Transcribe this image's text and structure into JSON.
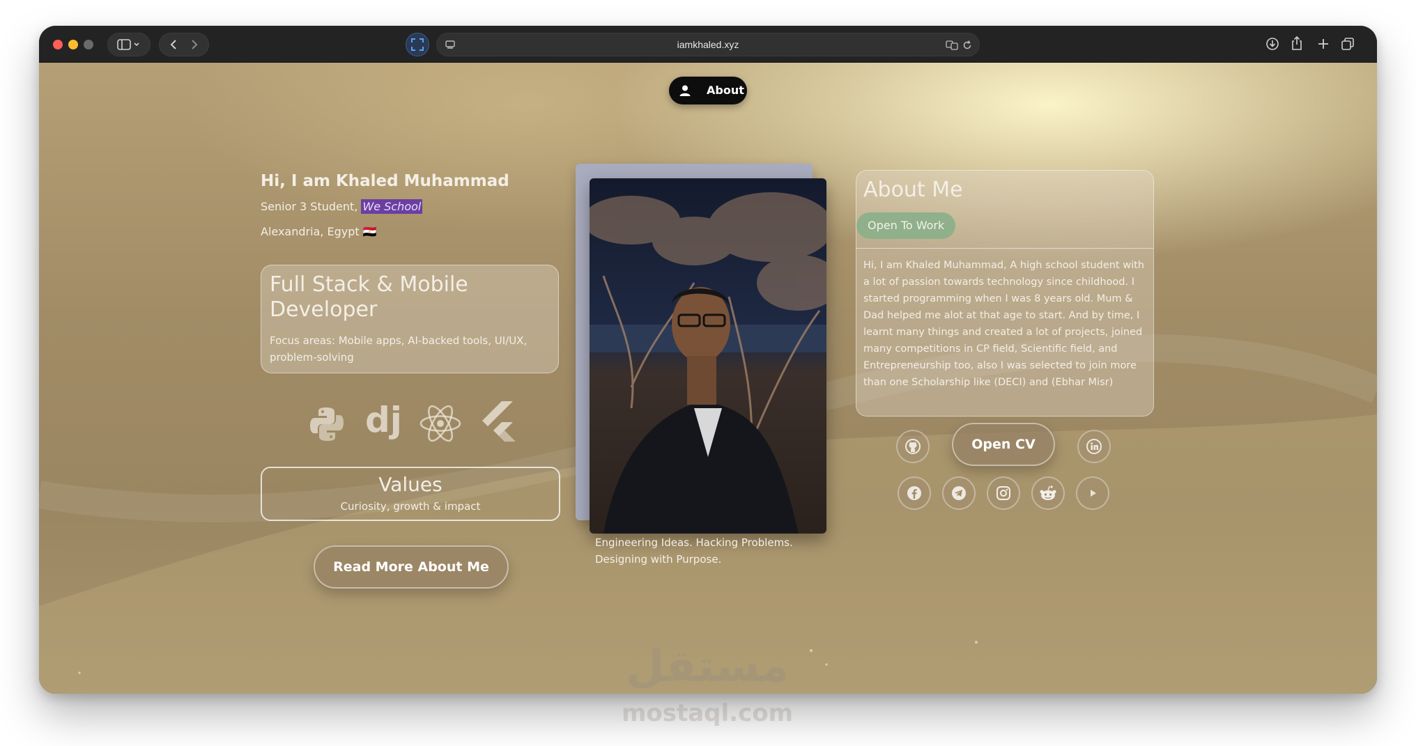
{
  "browser": {
    "url": "iamkhaled.xyz"
  },
  "nav": {
    "about_label": "About"
  },
  "hero": {
    "greeting": "Hi, I am Khaled Muhammad",
    "subtitle_prefix": "Senior 3 Student, ",
    "school": "We School",
    "location": "Alexandria, Egypt 🇪🇬"
  },
  "role_card": {
    "title": "Full Stack & Mobile Developer",
    "focus": "Focus areas: Mobile apps, AI-backed tools, UI/UX, problem-solving"
  },
  "tech_icons": [
    "python-icon",
    "django-icon",
    "react-icon",
    "flutter-icon"
  ],
  "values_card": {
    "title": "Values",
    "subtitle": "Curiosity, growth & impact"
  },
  "read_more_label": "Read More About Me",
  "photo_caption": "Engineering Ideas. Hacking Problems. Designing with Purpose.",
  "about_card": {
    "title": "About Me",
    "badge": "Open To Work",
    "body": "Hi, I am Khaled Muhammad, A high school student with a lot of passion towards technology since childhood. I started programming when I was 8 years old. Mum & Dad helped me alot at that age to start. And by time, I learnt many things and created a lot of projects, joined many competitions in CP field, Scientific field, and Entrepreneurship too, also I was selected to join more than one Scholarship like (DECI) and (Ebhar Misr)"
  },
  "open_cv_label": "Open CV",
  "socials": [
    "github-icon",
    "linkedin-icon",
    "facebook-icon",
    "telegram-icon",
    "instagram-icon",
    "reddit-icon",
    "youtube-icon"
  ],
  "watermark": {
    "arabic": "مستقل",
    "latin": "mostaql.com"
  },
  "colors": {
    "accent_badge": "#8fb08a",
    "school_highlight": "#6b3fa0",
    "nav_pill": "#0d0d0d"
  }
}
